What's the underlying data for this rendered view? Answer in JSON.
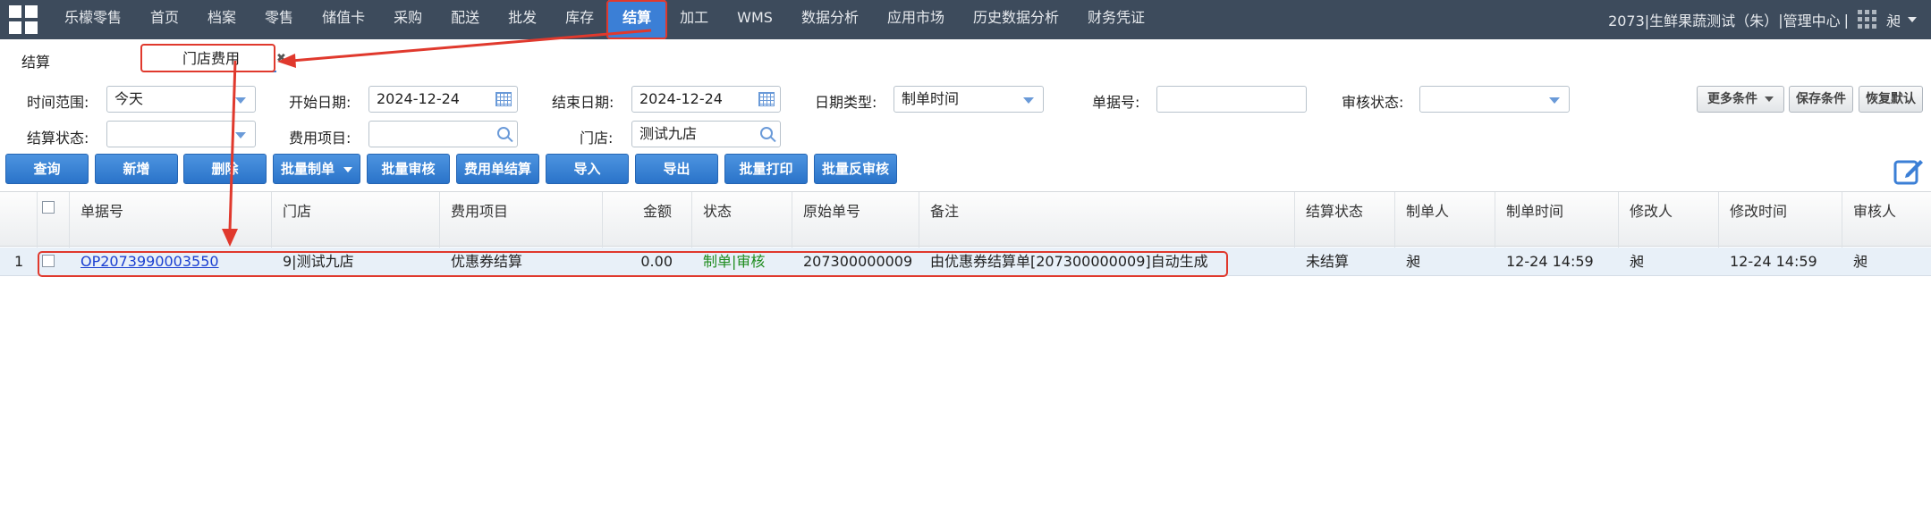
{
  "nav": {
    "items": [
      "乐檬零售",
      "首页",
      "档案",
      "零售",
      "储值卡",
      "采购",
      "配送",
      "批发",
      "库存",
      "结算",
      "加工",
      "WMS",
      "数据分析",
      "应用市场",
      "历史数据分析",
      "财务凭证"
    ],
    "active_index": 9,
    "org": "2073|生鲜果蔬测试（朱）",
    "separator_1": "|",
    "admin": "管理中心",
    "separator_2": "|",
    "user": "昶"
  },
  "tabs": {
    "main": "结算",
    "store_fee": "门店费用",
    "close": "✖"
  },
  "filters": {
    "time_range_label": "时间范围:",
    "time_range_value": "今天",
    "start_date_label": "开始日期:",
    "start_date_value": "2024-12-24",
    "end_date_label": "结束日期:",
    "end_date_value": "2024-12-24",
    "date_type_label": "日期类型:",
    "date_type_value": "制单时间",
    "doc_no_label": "单据号:",
    "doc_no_value": "",
    "audit_status_label": "审核状态:",
    "audit_status_value": "",
    "settle_status_label": "结算状态:",
    "settle_status_value": "",
    "fee_item_label": "费用项目:",
    "fee_item_value": "",
    "store_label": "门店:",
    "store_value": "测试九店",
    "more_conditions": "更多条件",
    "save_conditions": "保存条件",
    "restore_default": "恢复默认"
  },
  "actions": [
    "查询",
    "新增",
    "删除",
    "批量制单",
    "批量审核",
    "费用单结算",
    "导入",
    "导出",
    "批量打印",
    "批量反审核"
  ],
  "table": {
    "columns": [
      "单据号",
      "门店",
      "费用项目",
      "金额",
      "状态",
      "原始单号",
      "备注",
      "结算状态",
      "制单人",
      "制单时间",
      "修改人",
      "修改时间",
      "审核人"
    ],
    "rows": [
      {
        "index": "1",
        "doc_no": "OP2073990003550",
        "store": "9|测试九店",
        "fee_item": "优惠券结算",
        "amount": "0.00",
        "status": "制单|审核",
        "orig_no": "207300000009",
        "remark": "由优惠券结算单[207300000009]自动生成",
        "settle_status": "未结算",
        "creator": "昶",
        "created_at": "12-24 14:59",
        "modifier": "昶",
        "modified_at": "12-24 14:59",
        "auditor": "昶"
      }
    ]
  },
  "colors": {
    "nav_bg": "#3d4b5c",
    "accent": "#3b7fd6",
    "highlight": "#e0392d",
    "status_green": "#1e8c1e",
    "link": "#1a3fd1"
  },
  "icons": [
    "logo-grid-icon",
    "apps-grid-icon",
    "calendar-icon",
    "search-icon",
    "edit-icon",
    "chevron-down-icon"
  ]
}
